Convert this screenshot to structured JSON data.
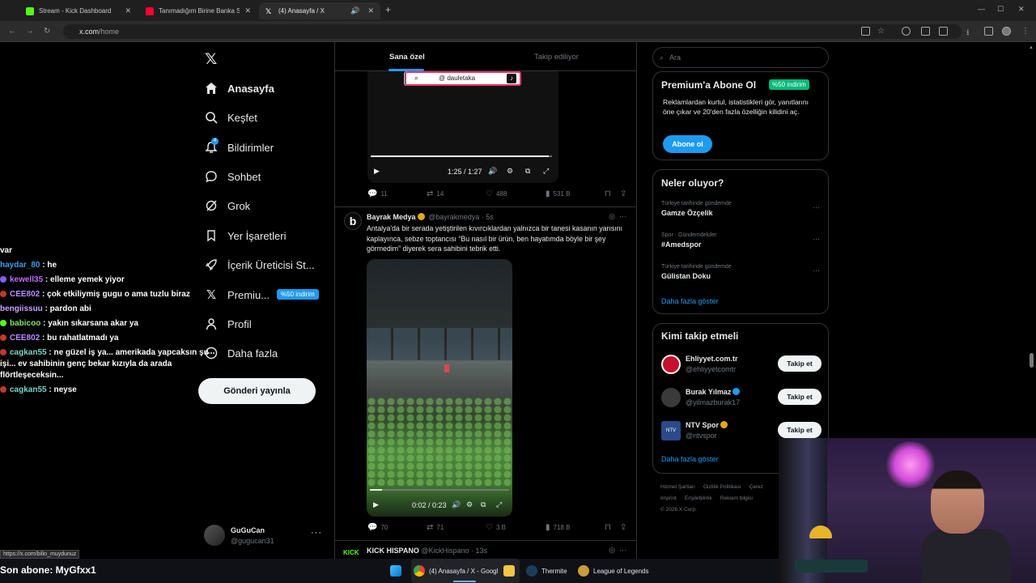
{
  "browser": {
    "tabs": [
      {
        "title": "Stream - Kick Dashboard",
        "color": "#53fc18"
      },
      {
        "title": "Tanımadığım Birine Banka Soyd...",
        "color": "#ff0033"
      },
      {
        "title": "(4) Anasayfa / X",
        "color": "#ffffff"
      }
    ],
    "url_host": "x.com",
    "url_path": "/home"
  },
  "nav": {
    "items": [
      {
        "label": "Anasayfa",
        "icon": "home-icon"
      },
      {
        "label": "Keşfet",
        "icon": "search-icon"
      },
      {
        "label": "Bildirimler",
        "icon": "bell-icon"
      },
      {
        "label": "Sohbet",
        "icon": "chat-icon"
      },
      {
        "label": "Grok",
        "icon": "grok-icon"
      },
      {
        "label": "Yer İşaretleri",
        "icon": "bookmark-icon"
      },
      {
        "label": "İçerik Üreticisi St...",
        "icon": "rocket-icon"
      },
      {
        "label": "Premiu...",
        "icon": "x-premium-icon"
      },
      {
        "label": "Profil",
        "icon": "profile-icon"
      },
      {
        "label": "Daha fazla",
        "icon": "more-circle-icon"
      }
    ],
    "premium_badge": "%50 indirim",
    "post_button": "Gönderi yayınla",
    "me_name": "GuGuCan",
    "me_handle": "@gugucan31",
    "notification_count": "4"
  },
  "chat": {
    "lines": [
      {
        "user": "",
        "text": "var",
        "color": "#ffffff"
      },
      {
        "user": "haydar_80",
        "text": " : he",
        "color": "#3b9ce8"
      },
      {
        "user": "kewell35",
        "text": " : elleme yemek yiyor",
        "color": "#c06bff"
      },
      {
        "user": "CEE802",
        "text": " : çok etkiliymiş gugu o ama tuzlu biraz",
        "color": "#b68aff"
      },
      {
        "user": "bengiissuu",
        "text": " : pardon abi",
        "color": "#c9a2ff"
      },
      {
        "user": "babicoo",
        "text": " : yakın sıkarsana akar ya",
        "color": "#7ce06b"
      },
      {
        "user": "CEE802",
        "text": " : bu rahatlatmadı ya",
        "color": "#b68aff"
      },
      {
        "user": "cagkan55",
        "text": " : ne güzel iş ya... amerikada yapcaksın şu işi... ev sahibinin genç bekar kızıyla da arada flörtleşeceksin...",
        "color": "#7ad3c8"
      },
      {
        "user": "cagkan55",
        "text": " : neyse",
        "color": "#7ad3c8"
      }
    ],
    "last_sub": "Son abone: MyGfxx1"
  },
  "status_url": "https://x.com/bilio_muydunuz",
  "timeline": {
    "tabs": [
      "Sana özel",
      "Takip ediliyor"
    ],
    "post1": {
      "tiktok_handle": "@ dauletaka",
      "video_time": "1:25 / 1:27",
      "video_progress": 0.98,
      "replies": "11",
      "reposts": "14",
      "likes": "488",
      "views": "531 B"
    },
    "post2": {
      "name": "Bayrak Medya",
      "handle": "@bayrakmedya · 5s",
      "text": "Antalya'da bir serada yetiştirilen kıvırcıklardan yalnızca bir tanesi kasanın yarısını kaplayınca, sebze toptancısı “Bu nasıl bir ürün, ben hayatımda böyle bir şey görmedim” diyerek sera sahibini tebrik etti.",
      "video_time": "0:02 / 0:23",
      "video_progress": 0.09,
      "replies": "70",
      "reposts": "71",
      "likes": "3 B",
      "views": "718 B"
    },
    "post3": {
      "name": "KICK HISPANO",
      "handle": "@KickHispano · 13s",
      "avatar_text": "KICK"
    }
  },
  "right": {
    "search_placeholder": "Ara",
    "premium": {
      "title": "Premium'a Abone Ol",
      "discount": "%50 indirim",
      "text": "Reklamlardan kurtul, istatistikleri gör, yanıtlarını öne çıkar ve 20'den fazla özelliğin kilidini aç.",
      "button": "Abone ol"
    },
    "trends": {
      "title": "Neler oluyor?",
      "items": [
        {
          "context": "Türkiye tarihinde gündemde",
          "topic": "Gamze Özçelik"
        },
        {
          "context": "Spor · Gündemdekiler",
          "topic": "#Amedspor"
        },
        {
          "context": "Türkiye tarihinde gündemde",
          "topic": "Gülistan Doku"
        }
      ],
      "more": "Daha fazla göster"
    },
    "who": {
      "title": "Kimi takip etmeli",
      "items": [
        {
          "name": "Ehliyyet.com.tr",
          "handle": "@ehliyyetcomtr",
          "follow": "Takip et",
          "avatar_color": "#c8102e"
        },
        {
          "name": "Burak Yılmaz",
          "handle": "@yilmazburak17",
          "follow": "Takip et",
          "avatar_color": "#3a3a3a"
        },
        {
          "name": "NTV Spor",
          "handle": "@ntvspor",
          "follow": "Takip et",
          "avatar_color": "#2a4a8a"
        }
      ],
      "more": "Daha fazla göster"
    },
    "footer": [
      "Hizmet Şartları",
      "Gizlilik Politikası",
      "Çerez",
      "Imprint",
      "Erişilebilirlik",
      "Reklam bilgisi",
      "© 2026 X Corp."
    ]
  },
  "taskbar": {
    "items": [
      "(4) Anasayfa / X - Googl",
      "Thermite",
      "League of Legends"
    ]
  }
}
